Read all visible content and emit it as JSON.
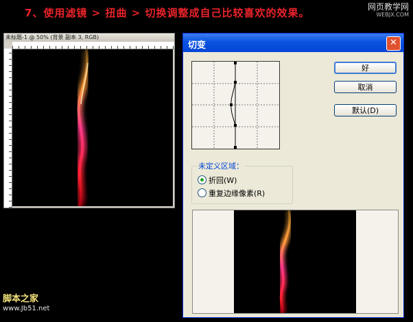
{
  "header": {
    "step_text": "7、使用滤镜 > 扭曲 > 切换调整成自己比较喜欢的效果。"
  },
  "site_logo": {
    "name": "网页教学网",
    "url": "WEBJX.COM"
  },
  "ps_window": {
    "title": "未标题-1 @ 50% (背景 副本 3, RGB)"
  },
  "dialog": {
    "title": "切变",
    "buttons": {
      "ok": "好",
      "cancel": "取消",
      "default": "默认(D)"
    },
    "undefined_area": {
      "label": "未定义区域：",
      "options": [
        {
          "label": "折回(W)",
          "checked": true
        },
        {
          "label": "重复边缘像素(R)",
          "checked": false
        }
      ]
    }
  },
  "watermark": {
    "name": "脚本之家",
    "url": "www.Jb51.net"
  },
  "colors": {
    "step_text": "#e8232a",
    "title_bar": "#0a53e0",
    "dialog_bg": "#ece9d8"
  }
}
